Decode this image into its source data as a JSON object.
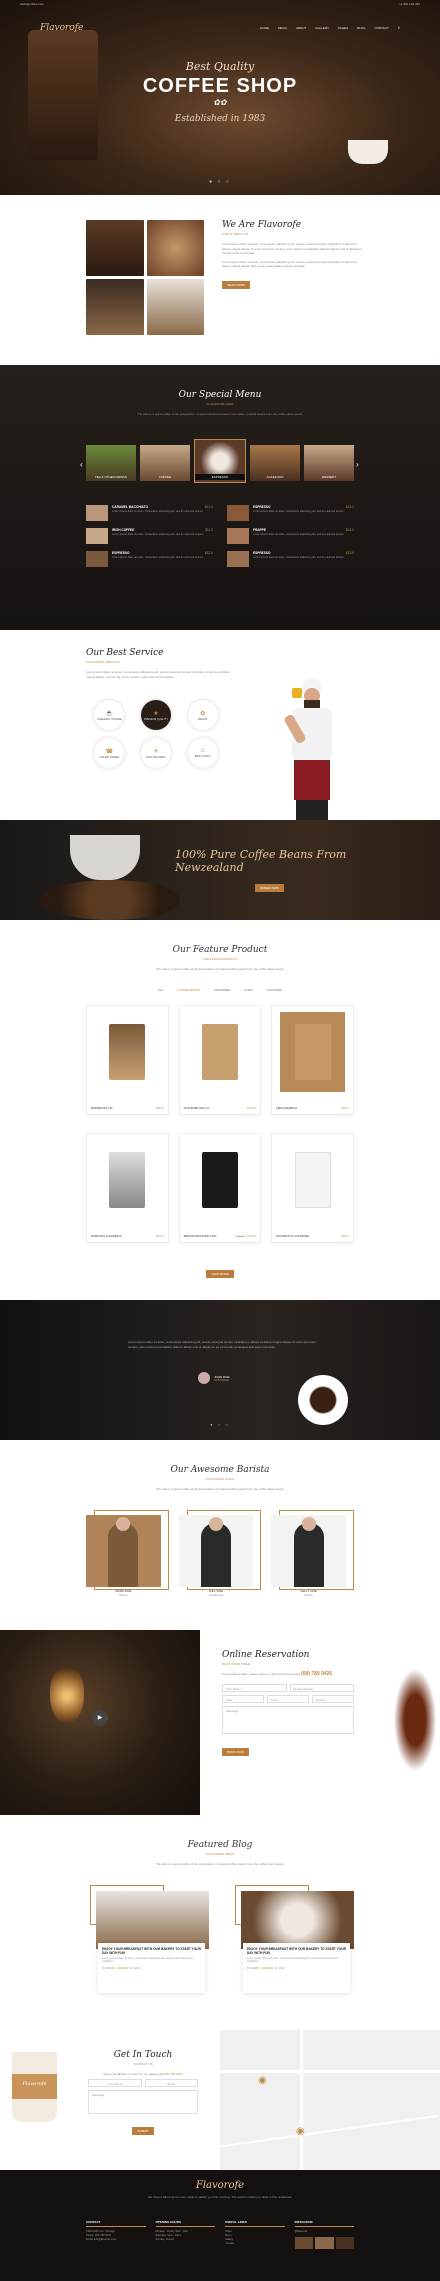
{
  "topbar": {
    "left": "hello@coffee.com",
    "right": "+1 800 123 456"
  },
  "nav": {
    "logo": "Flavorofe",
    "items": [
      "HOME",
      "MENU",
      "ABOUT",
      "GALLERY",
      "PAGES",
      "BLOG",
      "CONTACT"
    ]
  },
  "hero": {
    "line1": "Best Quality",
    "title": "COFFEE SHOP",
    "line3": "Established in 1983"
  },
  "about": {
    "title": "We Are Flavorofe",
    "subtitle": "WHO & ABOUT US",
    "para1": "Lorem ipsum dolor sit amet, consectetur adipiscing elit, sed do eiusmod tempor incididunt ut labore et dolore magna aliqua. Ut enim ad minim veniam, quis nostrud exercitation ullamco laboris nisi ut aliquip ex ea commodo consequat.",
    "para2": "Lorem ipsum dolor sit amet, consectetur adipiscing elit, sed do eiusmod tempor incididunt ut labore et dolore magna aliqua. Quis ipsum suspendisse ultrices gravida.",
    "button": "READ MORE"
  },
  "special_menu": {
    "title": "Our Special Menu",
    "subtitle": "FLAVOROFE CAFE",
    "desc": "The safe is a great coffee of the preparation of ground beans brewed in hot water, roasted beans from the coffee plant seeds.",
    "tabs": [
      "TEA & OTHER DRINKS",
      "COFFEE",
      "ESPRESSO",
      "CAKEFOOD",
      "DESSERT"
    ],
    "active_tab": "ESPRESSO",
    "items": [
      {
        "name": "CARAMEL MACCHIATO",
        "price": "$12.0",
        "desc": "Lorem ipsum dolor sit amet, consectetur adipiscing elit, sed do eiusmod tempor."
      },
      {
        "name": "ESPRESSO",
        "price": "$13.0",
        "desc": "Lorem ipsum dolor sit amet, consectetur adipiscing elit, sed do eiusmod tempor."
      },
      {
        "name": "IRISH COFFEE",
        "price": "$11.0",
        "desc": "Lorem ipsum dolor sit amet, consectetur adipiscing elit, sed do eiusmod tempor."
      },
      {
        "name": "FRAPPE",
        "price": "$13.0",
        "desc": "Lorem ipsum dolor sit amet, consectetur adipiscing elit, sed do eiusmod tempor."
      },
      {
        "name": "ESPRESSO",
        "price": "$12.0",
        "desc": "Lorem ipsum dolor sit amet, consectetur adipiscing elit, sed do eiusmod tempor."
      },
      {
        "name": "ESPRESSO",
        "price": "$12.0",
        "desc": "Lorem ipsum dolor sit amet, consectetur adipiscing elit, sed do eiusmod tempor."
      }
    ]
  },
  "service": {
    "title": "Our Best Service",
    "subtitle": "FLAVOROFE SERVICES",
    "desc": "Lorem ipsum dolor sit amet, consectetur adipiscing elit, sed do eiusmod tempor incididunt ut labore et dolore magna aliqua. Ut enim ad minim veniam, quis nostrud exercitation.",
    "items": [
      "TAKEAWAY COFFEE",
      "PREMIUM QUALITY",
      "BEANS",
      "ONLINE ORDER",
      "FAST DELIVERY",
      "BEST STAFF"
    ]
  },
  "banner": {
    "text": "100% Pure Coffee Beans From Newzealand",
    "button": "ORDER NOW"
  },
  "products": {
    "title": "Our Feature Product",
    "subtitle": "OUR FLAVOR PRODUCT",
    "desc": "The safe is a great coffee of the preparation of roasted coffee beans from the coffee plant seeds.",
    "filters": [
      "ALL",
      "COFFEE BEANS",
      "MACHINES",
      "CUPS",
      "CLOTHING"
    ],
    "active_filter": "COFFEE BEANS",
    "items": [
      {
        "name": "ESPRESSO UP",
        "price": "$50.0",
        "old": ""
      },
      {
        "name": "FLAVROBLACK 2L",
        "price": "$120.0",
        "old": ""
      },
      {
        "name": "NEW ARABICA",
        "price": "$50.0",
        "old": ""
      },
      {
        "name": "ROBUSTA & ARABICA",
        "price": "$54.0",
        "old": ""
      },
      {
        "name": "BEANS ROASTED TINY",
        "price": "$120.0",
        "old": "$150.0"
      },
      {
        "name": "RISTRETTO CAFFEINE",
        "price": "$50.0",
        "old": ""
      }
    ],
    "button": "VIEW MORE"
  },
  "testimonial": {
    "quote": "Lorem ipsum dolor sit amet, consectetur adipiscing elit, sed do eiusmod tempor incididunt ut labore et dolore magna aliqua. Ut enim ad minim veniam, quis nostrud exercitation ullamco laboris nisi ut aliquip ex ea commodo consequat duis aute irure dolor.",
    "name": "JOHN DOE",
    "role": "CUSTOMER"
  },
  "baristas": {
    "title": "Our Awesome Barista",
    "subtitle": "FLAVOROFE STAFF",
    "desc": "The safe is a great coffee of the preparation of roasted coffee beans from the coffee plant seeds.",
    "items": [
      {
        "name": "MARK DOE",
        "role": "Barista"
      },
      {
        "name": "WILL DOE",
        "role": "Headbarista"
      },
      {
        "name": "KELLY DOE",
        "role": "Barista"
      }
    ]
  },
  "reservation": {
    "title": "Online Reservation",
    "subtitle": "BOOK YOUR TABLE",
    "desc": "For booking a table, please call us or fill out the form below",
    "phone": "(08) 789 9426",
    "fields": [
      "Your Name",
      "Email Address",
      "Date",
      "Time",
      "Person",
      "Message"
    ],
    "button": "BOOK NOW"
  },
  "blog": {
    "title": "Featured Blog",
    "subtitle": "FLAVOROFE NEWS",
    "desc": "The safe is a great coffee of the preparation of roasted coffee beans from the coffee plant seeds.",
    "posts": [
      {
        "title": "ENJOY YOUR BREAKFAST WITH OUR BAKERY TO START YOUR DAY WITH FUN",
        "excerpt": "Lorem ipsum dolor sit amet, consectetur adipiscing elit, sed do eiusmod tempor incididunt.",
        "meta": "BY ADMIN · JANUARY 20, 2019"
      },
      {
        "title": "ENJOY YOUR BREAKFAST WITH OUR BAKERY TO START YOUR DAY WITH FUN",
        "excerpt": "Lorem ipsum dolor sit amet, consectetur adipiscing elit, sed do eiusmod tempor incididunt.",
        "meta": "BY ADMIN · JANUARY 20, 2019"
      }
    ]
  },
  "contact": {
    "title": "Get In Touch",
    "subtitle": "CONTACT US",
    "desc": "Have a feedback or review for us, please call",
    "phone": "(08) 789 9426",
    "fields": [
      "Your Name",
      "Email",
      "Message"
    ],
    "button": "SUBMIT",
    "cup_logo": "Flavorofe"
  },
  "footer": {
    "logo": "Flavorofe",
    "tagline": "We have a flavoring for every taste to satisfy you this morning. The world is waiting to taste in this restaurant.",
    "columns": [
      {
        "title": "CONTACT",
        "lines": [
          "1234 North Ave, Chicago",
          "Phone: (08) 789 9426",
          "Email: info@flavorofe.com"
        ]
      },
      {
        "title": "OPENING HOURS",
        "lines": [
          "Monday - Friday: 8am - 9pm",
          "Saturday: 9am - 10pm",
          "Sunday: Closed"
        ]
      },
      {
        "title": "USEFUL LINKS",
        "lines": [
          "About",
          "Menu",
          "Gallery",
          "Contact"
        ]
      },
      {
        "title": "INSTAGRAM",
        "lines": [
          "@flavorofe"
        ]
      }
    ]
  }
}
